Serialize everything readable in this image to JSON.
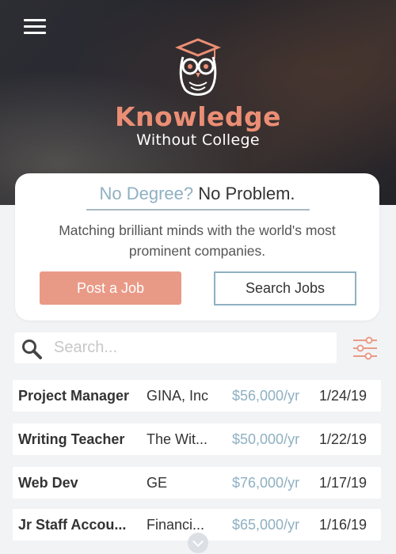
{
  "header": {
    "brand_main": "Knowledge",
    "brand_sub": "Without College",
    "menu_icon": "hamburger-menu-icon",
    "logo_icon": "owl-graduation-logo"
  },
  "hero_card": {
    "tagline_question": "No Degree?",
    "tagline_answer": "No Problem.",
    "subtitle": "Matching brilliant minds with the world's most prominent companies.",
    "post_button": "Post a Job",
    "search_button": "Search Jobs"
  },
  "search": {
    "placeholder": "Search...",
    "value": "",
    "icon": "search-icon",
    "filter_icon": "sliders-filter-icon"
  },
  "jobs": [
    {
      "title": "Project Manager",
      "company": "GINA, Inc",
      "salary": "$56,000/yr",
      "date": "1/24/19"
    },
    {
      "title": "Writing Teacher",
      "company": "The Wit...",
      "salary": "$50,000/yr",
      "date": "1/22/19"
    },
    {
      "title": "Web Dev",
      "company": "GE",
      "salary": "$76,000/yr",
      "date": "1/17/19"
    },
    {
      "title": "Jr Staff Accou...",
      "company": "Financi...",
      "salary": "$65,000/yr",
      "date": "1/16/19"
    }
  ],
  "colors": {
    "accent_coral": "#e99a87",
    "accent_blue": "#8fb0c2",
    "background": "#f2f3f5"
  }
}
